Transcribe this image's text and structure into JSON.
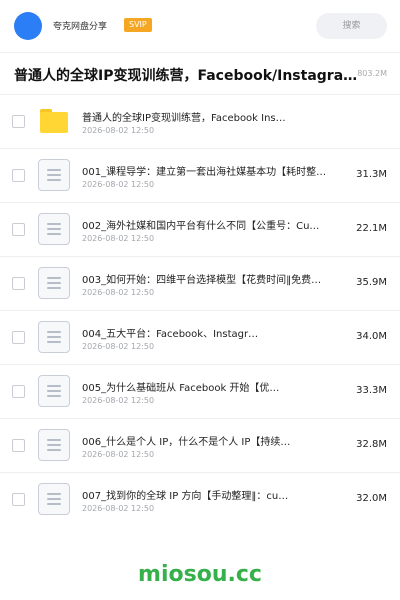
{
  "header": {
    "owner_name": "夸克网盘分享",
    "badge": "SVIP",
    "search_placeholder": "搜索"
  },
  "folder_title": "普通人的全球IP变现训练营，Facebook/Instagram…",
  "folder_total_size": "803.2M",
  "files": [
    {
      "type": "folder",
      "name": "普通人的全球IP变现训练营，Facebook Ins…",
      "date": "2026-08-02 12:50",
      "size": ""
    },
    {
      "type": "file",
      "name": "001_课程导学：建立第一套出海社媒基本功【耗时整…",
      "date": "2026-08-02 12:50",
      "size": "31.3M"
    },
    {
      "type": "file",
      "name": "002_海外社媒和国内平台有什么不同【公重号：Cu…",
      "date": "2026-08-02 12:50",
      "size": "22.1M"
    },
    {
      "type": "file",
      "name": "003_如何开始：四维平台选择模型【花费时间‖免费…",
      "date": "2026-08-02 12:50",
      "size": "35.9M"
    },
    {
      "type": "file",
      "name": "004_五大平台：Facebook、Instagr…",
      "date": "2026-08-02 12:50",
      "size": "34.0M"
    },
    {
      "type": "file",
      "name": "005_为什么基础班从 Facebook 开始【优…",
      "date": "2026-08-02 12:50",
      "size": "33.3M"
    },
    {
      "type": "file",
      "name": "006_什么是个人 IP，什么不是个人 IP【持续…",
      "date": "2026-08-02 12:50",
      "size": "32.8M"
    },
    {
      "type": "file",
      "name": "007_找到你的全球 IP 方向【手动整理‖：cu…",
      "date": "2026-08-02 12:50",
      "size": "32.0M"
    }
  ],
  "watermark": "miosou.cc",
  "colors": {
    "avatar": "#2b7ef6",
    "badge": "#f5a623",
    "folder": "#ffd633",
    "watermark": "#35b04a"
  },
  "icons": {
    "folder": "folder-icon",
    "file": "document-icon"
  }
}
